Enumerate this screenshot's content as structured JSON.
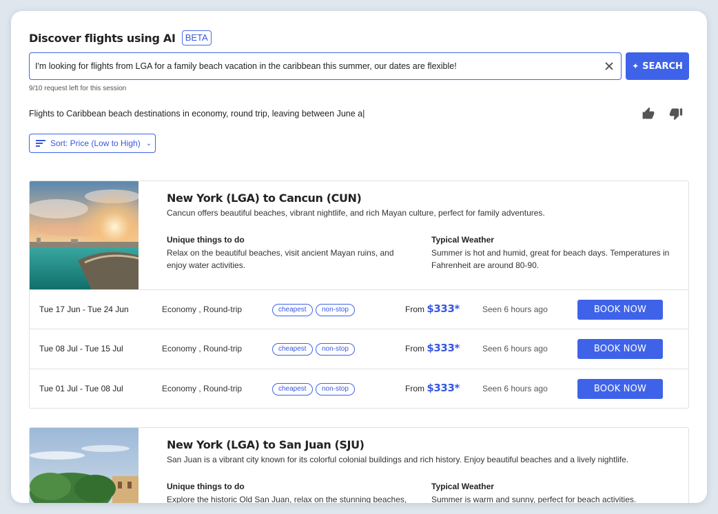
{
  "header": {
    "title": "Discover flights using AI",
    "badge": "BETA"
  },
  "search": {
    "query": "I'm looking for flights from LGA for a family beach vacation in the caribbean this summer, our dates are flexible!",
    "button_label": "SEARCH",
    "quota": "9/10 request left for this session"
  },
  "summary": "Flights to Caribbean beach destinations in economy, round trip, leaving between June a|",
  "sort": {
    "label": "Sort: Price (Low to High)"
  },
  "colors": {
    "accent": "#3f63e8",
    "price": "#3857e0"
  },
  "results": [
    {
      "title": "New York (LGA) to Cancun (CUN)",
      "description": "Cancun offers beautiful beaches, vibrant nightlife, and rich Mayan culture, perfect for family adventures.",
      "things_heading": "Unique things to do",
      "things_text": "Relax on the beautiful beaches, visit ancient Mayan ruins, and enjoy water activities.",
      "weather_heading": "Typical Weather",
      "weather_text": "Summer is hot and humid, great for beach days. Temperatures in Fahrenheit are around 80-90.",
      "flights": [
        {
          "dates": "Tue 17 Jun  - Tue 24 Jun",
          "cabin": "Economy , Round-trip",
          "tag1": "cheapest",
          "tag2": "non-stop",
          "from": "From",
          "price": "$333*",
          "seen": "Seen 6 hours ago",
          "book": "BOOK NOW"
        },
        {
          "dates": "Tue 08 Jul  - Tue 15 Jul",
          "cabin": "Economy , Round-trip",
          "tag1": "cheapest",
          "tag2": "non-stop",
          "from": "From",
          "price": "$333*",
          "seen": "Seen 6 hours ago",
          "book": "BOOK NOW"
        },
        {
          "dates": "Tue 01 Jul  - Tue 08 Jul",
          "cabin": "Economy , Round-trip",
          "tag1": "cheapest",
          "tag2": "non-stop",
          "from": "From",
          "price": "$333*",
          "seen": "Seen 6 hours ago",
          "book": "BOOK NOW"
        }
      ]
    },
    {
      "title": "New York (LGA) to San Juan (SJU)",
      "description": "San Juan is a vibrant city known for its colorful colonial buildings and rich history. Enjoy beautiful beaches and a lively nightlife.",
      "things_heading": "Unique things to do",
      "things_text": "Explore the historic Old San Juan, relax on the stunning beaches,",
      "weather_heading": "Typical Weather",
      "weather_text": "Summer is warm and sunny, perfect for beach activities."
    }
  ]
}
